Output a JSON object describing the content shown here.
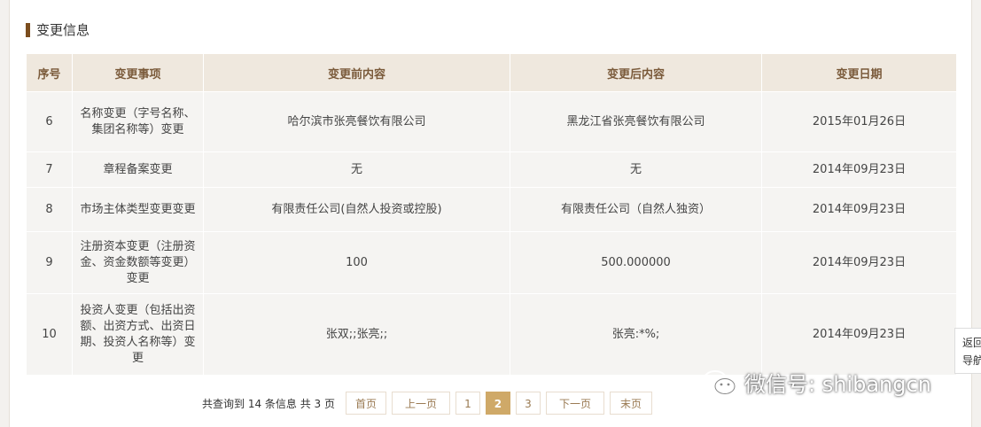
{
  "section": {
    "title": "变更信息"
  },
  "table": {
    "headers": [
      "序号",
      "变更事项",
      "变更前内容",
      "变更后内容",
      "变更日期"
    ],
    "rows": [
      [
        "6",
        "名称变更（字号名称、集团名称等）变更",
        "哈尔滨市张亮餐饮有限公司",
        "黑龙江省张亮餐饮有限公司",
        "2015年01月26日"
      ],
      [
        "7",
        "章程备案变更",
        "无",
        "无",
        "2014年09月23日"
      ],
      [
        "8",
        "市场主体类型变更变更",
        "有限责任公司(自然人投资或控股)",
        "有限责任公司（自然人独资）",
        "2014年09月23日"
      ],
      [
        "9",
        "注册资本变更（注册资金、资金数额等变更）变更",
        "100",
        "500.000000",
        "2014年09月23日"
      ],
      [
        "10",
        "投资人变更（包括出资额、出资方式、出资日期、投资人名称等）变更",
        "张双;;张亮;;",
        "张亮:*%;",
        "2014年09月23日"
      ]
    ]
  },
  "pagination": {
    "info": "共查询到 14 条信息 共 3 页",
    "first": "首页",
    "prev": "上一页",
    "pages": [
      "1",
      "2",
      "3"
    ],
    "current": "2",
    "next": "下一页",
    "last": "末页"
  },
  "watermark": {
    "text": "微信号: shibangcn",
    "icon": "wechat-icon"
  },
  "side": {
    "back_label": "返回导航"
  },
  "colors": {
    "header_bg": "#efe8de",
    "accent": "#cfa968",
    "title_bar": "#7b4d1e"
  }
}
